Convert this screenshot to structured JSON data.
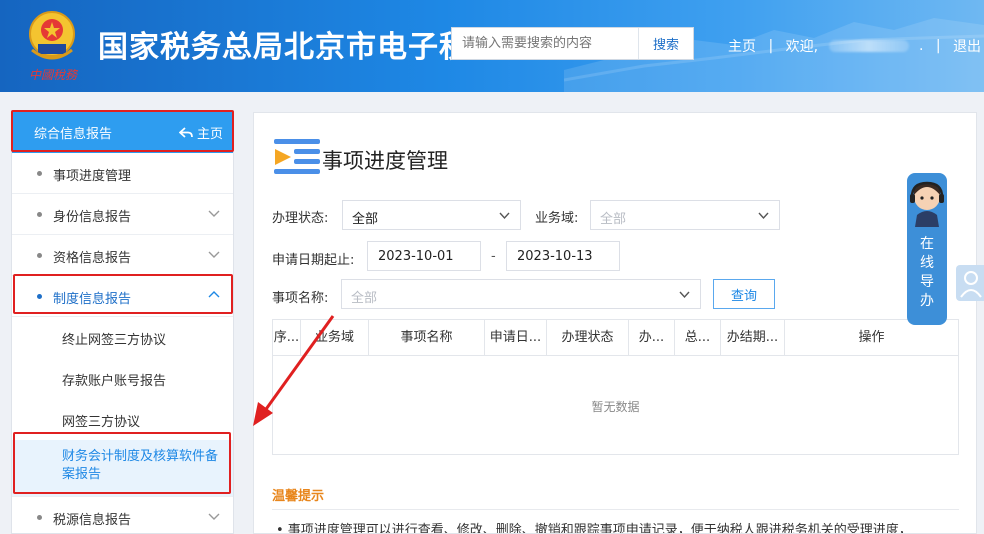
{
  "header": {
    "site_title": "国家税务总局北京市电子税务局",
    "logo_script": "中國稅務",
    "search_placeholder": "请输入需要搜索的内容",
    "search_button": "搜索",
    "home_link": "主页",
    "welcome_text": "欢迎,",
    "welcome_suffix": ".",
    "logout_link": "退出",
    "separator": "|"
  },
  "sidebar": {
    "header_title": "综合信息报告",
    "home_label": "主页",
    "items": [
      {
        "label": "事项进度管理",
        "expandable": false
      },
      {
        "label": "身份信息报告",
        "expandable": true
      },
      {
        "label": "资格信息报告",
        "expandable": true
      },
      {
        "label": "制度信息报告",
        "expandable": true,
        "expanded": true
      },
      {
        "label": "税源信息报告",
        "expandable": true
      }
    ],
    "subitems": [
      {
        "label": "终止网签三方协议"
      },
      {
        "label": "存款账户账号报告"
      },
      {
        "label": "网签三方协议"
      },
      {
        "label": "财务会计制度及核算软件备案报告",
        "selected": true
      }
    ]
  },
  "main": {
    "title": "事项进度管理",
    "form": {
      "status_label": "办理状态:",
      "status_value": "全部",
      "domain_label": "业务域:",
      "domain_placeholder": "全部",
      "date_label": "申请日期起止:",
      "date_start": "2023-10-01",
      "date_separator": "-",
      "date_end": "2023-10-13",
      "item_label": "事项名称:",
      "item_placeholder": "全部",
      "query_button": "查询"
    },
    "table": {
      "columns": [
        "序...",
        "业务域",
        "事项名称",
        "申请日...",
        "办理状态",
        "办...",
        "总...",
        "办结期...",
        "操作"
      ],
      "empty_text": "暂无数据"
    },
    "tips": {
      "title": "温馨提示",
      "text": "• 事项进度管理可以进行查看、修改、删除、撤销和跟踪事项申请记录，便于纳税人跟进税务机关的受理进度，"
    }
  },
  "widgets": {
    "guide_text": "在线导办"
  },
  "colors": {
    "header_blue": "#1e88e5",
    "sidebar_head": "#2e9df0",
    "accent": "#1e88e5",
    "highlight_box": "#e02020",
    "tips_title": "#e8861c"
  }
}
